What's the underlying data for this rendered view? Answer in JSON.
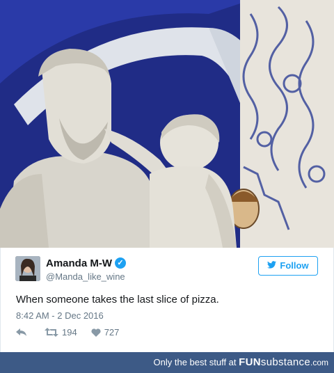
{
  "image": {
    "description_icon": "statue-photo"
  },
  "tweet": {
    "avatar_icon": "user-avatar",
    "name": "Amanda M-W",
    "verified_icon": "verified-badge-icon",
    "handle": "@Manda_like_wine",
    "follow_label": "Follow",
    "text": "When someone takes the last slice of pizza.",
    "timestamp": "8:42 AM - 2 Dec 2016",
    "retweets": "194",
    "likes": "727"
  },
  "footer": {
    "prefix": "Only the best stuff at",
    "brand_bold": "FUN",
    "brand_light": "substance",
    "suffix": ".com"
  },
  "colors": {
    "twitter_blue": "#1da1f2",
    "footer_bg": "#3d5a86"
  }
}
